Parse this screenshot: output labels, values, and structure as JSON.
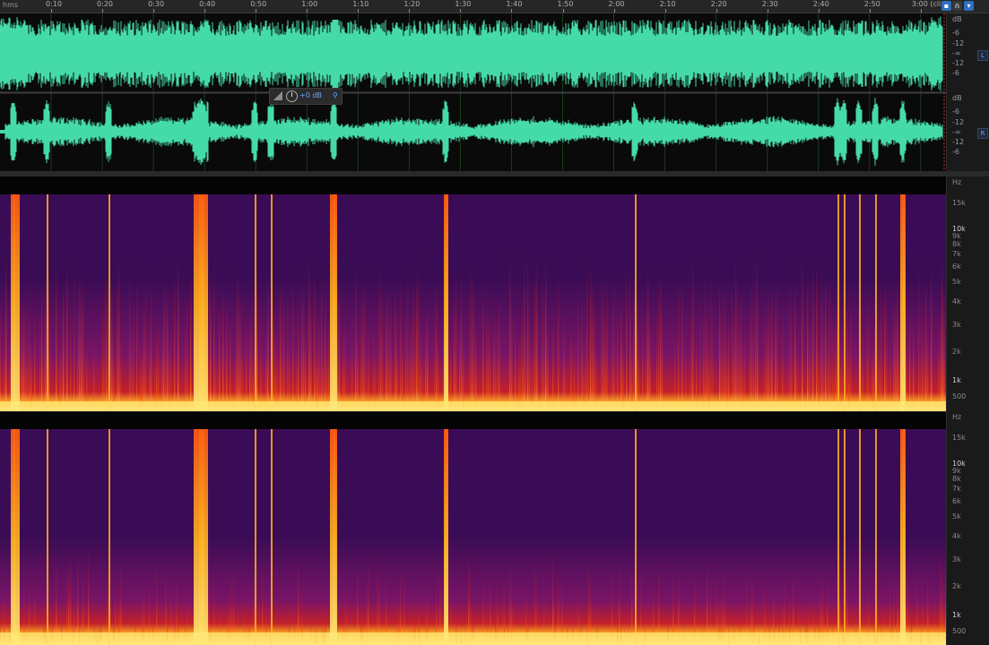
{
  "ruler": {
    "unit": "hms",
    "ticks": [
      "0:10",
      "0:20",
      "0:30",
      "0:40",
      "0:50",
      "1:00",
      "1:10",
      "1:20",
      "1:30",
      "1:40",
      "1:50",
      "2:00",
      "2:10",
      "2:20",
      "2:30",
      "2:40",
      "2:50",
      "3:00 (clip)"
    ]
  },
  "waveform": {
    "color": "#45dba8",
    "db_unit": "dB",
    "left_channel": {
      "badge": "L",
      "labels": [
        "-6",
        "-12",
        "-∞",
        "-12",
        "-6"
      ]
    },
    "right_channel": {
      "badge": "R",
      "labels": [
        "-6",
        "-12",
        "-∞",
        "-12",
        "-6"
      ]
    }
  },
  "gain_hud": {
    "value": "+0 dB"
  },
  "spectrogram": {
    "unit": "Hz",
    "freq_labels": [
      "15k",
      "10k",
      "9k",
      "8k",
      "7k",
      "6k",
      "5k",
      "4k",
      "3k",
      "2k",
      "1k",
      "500"
    ],
    "palette": [
      "#12062a",
      "#3a0c55",
      "#7a1466",
      "#c2202a",
      "#ff5a10",
      "#ffb020",
      "#ffe87a"
    ]
  }
}
